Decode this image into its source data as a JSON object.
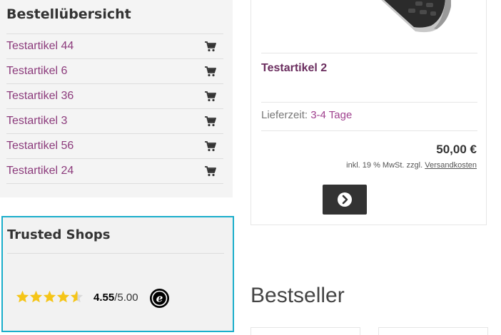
{
  "order_overview": {
    "title": "Bestellübersicht",
    "items": [
      {
        "label": "Testartikel 44",
        "icon": "cart-icon"
      },
      {
        "label": "Testartikel 6",
        "icon": "cart-icon"
      },
      {
        "label": "Testartikel 36",
        "icon": "cart-icon"
      },
      {
        "label": "Testartikel 3",
        "icon": "cart-icon"
      },
      {
        "label": "Testartikel 56",
        "icon": "cart-icon"
      },
      {
        "label": "Testartikel 24",
        "icon": "cart-icon"
      }
    ]
  },
  "trusted_shops": {
    "title": "Trusted Shops",
    "score": "4.55",
    "max": "/5.00",
    "stars": 4.55,
    "logo_icon": "trusted-shops-e-icon"
  },
  "product": {
    "name": "Testartikel 2",
    "delivery_label": "Lieferzeit:",
    "delivery_value": "3-4 Tage",
    "price": "50,00 €",
    "tax_note_prefix": "inkl. 19 % MwSt. zzgl.",
    "shipping_link": "Versandkosten",
    "detail_icon": "chevron-right-circle-icon"
  },
  "bestseller": {
    "title": "Bestseller"
  },
  "colors": {
    "link": "#8c3b7c",
    "accent_border": "#1aaecb",
    "star": "#f5c518",
    "button": "#333333"
  }
}
